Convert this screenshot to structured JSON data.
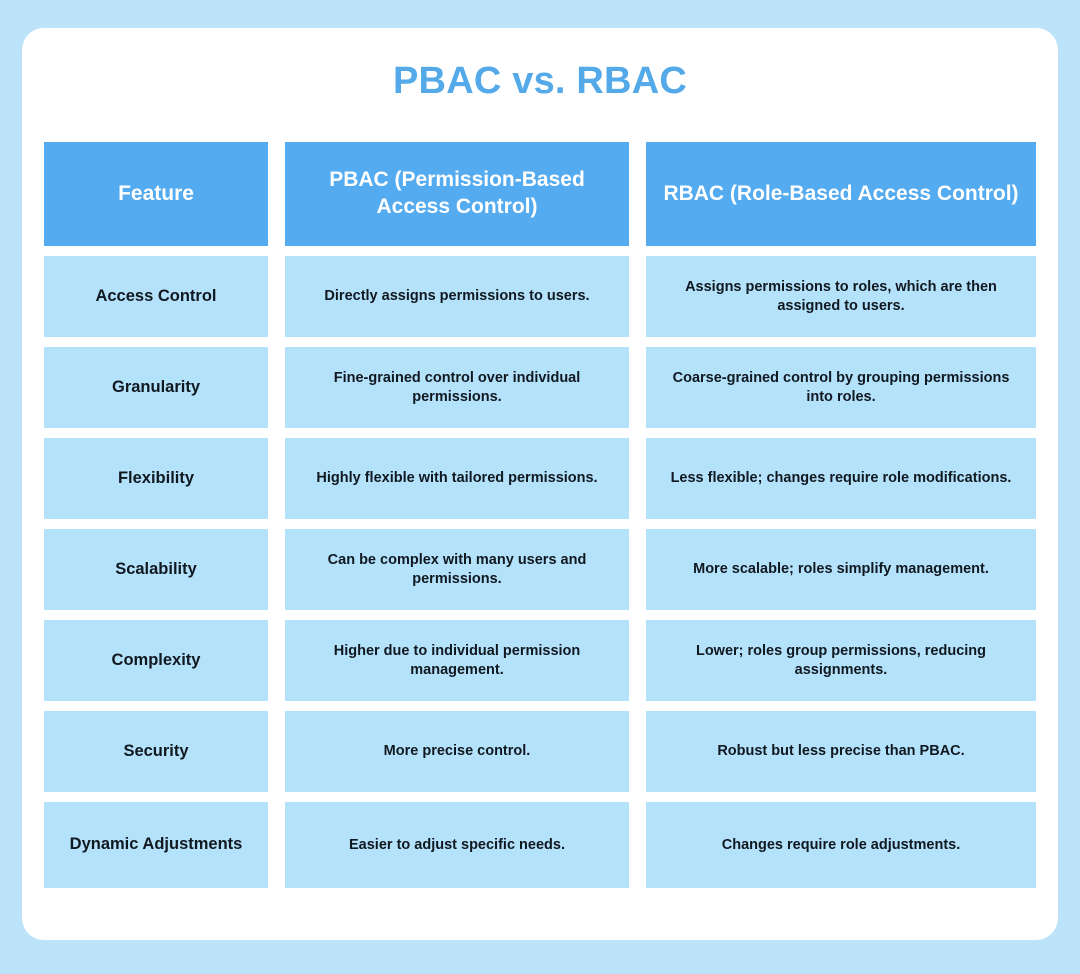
{
  "page": {
    "title": "PBAC vs. RBAC",
    "background_color": "#bde3fb",
    "card_color": "#ffffff",
    "title_color": "#54a9e8",
    "header_cell_color": "#54abef",
    "body_cell_color": "#b5e2fb",
    "header_text_color": "#ffffff",
    "body_text_color": "#101820"
  },
  "table": {
    "headers": {
      "feature": "Feature",
      "pbac": "PBAC (Permission-Based Access Control)",
      "rbac": "RBAC (Role-Based Access Control)"
    },
    "rows": [
      {
        "feature": "Access Control",
        "pbac": "Directly assigns permissions to users.",
        "rbac": "Assigns permissions to roles, which are then assigned to users."
      },
      {
        "feature": "Granularity",
        "pbac": "Fine-grained control over individual permissions.",
        "rbac": "Coarse-grained control by grouping permissions into roles."
      },
      {
        "feature": "Flexibility",
        "pbac": "Highly flexible with tailored permissions.",
        "rbac": "Less flexible; changes require role modifications."
      },
      {
        "feature": "Scalability",
        "pbac": "Can be complex with many users and permissions.",
        "rbac": "More scalable; roles simplify management."
      },
      {
        "feature": "Complexity",
        "pbac": "Higher due to individual permission management.",
        "rbac": "Lower; roles group permissions, reducing assignments."
      },
      {
        "feature": "Security",
        "pbac": "More precise control.",
        "rbac": "Robust but less precise than PBAC."
      },
      {
        "feature": "Dynamic Adjustments",
        "pbac": "Easier to adjust specific needs.",
        "rbac": "Changes require role adjustments."
      }
    ]
  }
}
